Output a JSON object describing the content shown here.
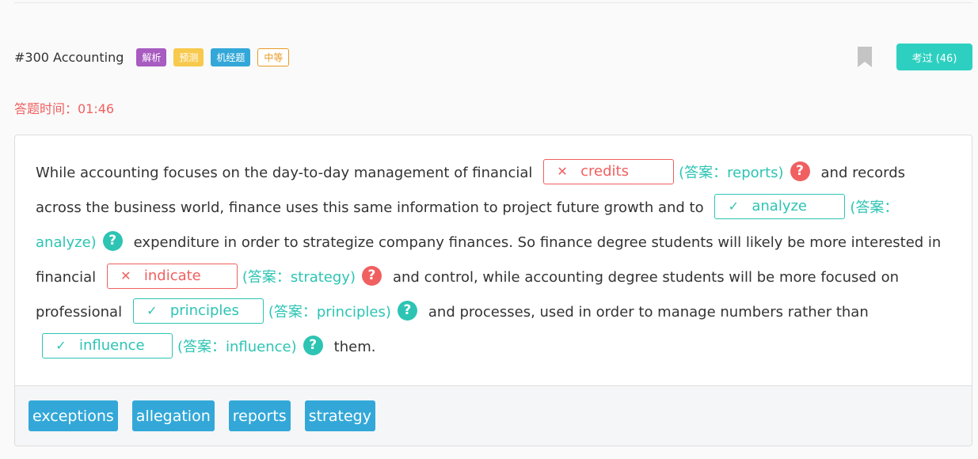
{
  "question": {
    "title": "#300 Accounting",
    "tags": [
      "解析",
      "预测",
      "机经题",
      "中等"
    ],
    "kaoguo_label": "考过 (46)",
    "timer": "答题时间：01:46"
  },
  "passage": {
    "text1": "While accounting focuses on the day-to-day management of financial",
    "text2": "and records across the business world, finance uses this same information to project future growth and to",
    "text3": "expenditure in order to strategize company finances. So finance degree students will likely be more interested in financial",
    "text4": "and control, while accounting degree students will be more focused on professional",
    "text5": "and processes, used in order to manage numbers rather than",
    "text6": "them.",
    "blanks": [
      {
        "mark": "✕",
        "value": "credits",
        "answer": "(答案：reports)",
        "status": "wrong"
      },
      {
        "mark": "✓",
        "value": "analyze",
        "answer": "(答案：analyze)",
        "status": "right"
      },
      {
        "mark": "✕",
        "value": "indicate",
        "answer": "(答案：strategy)",
        "status": "wrong"
      },
      {
        "mark": "✓",
        "value": "principles",
        "answer": "(答案：principles)",
        "status": "right"
      },
      {
        "mark": "✓",
        "value": "influence",
        "answer": "(答案：influence)",
        "status": "right"
      }
    ],
    "help_glyph": "?"
  },
  "word_bank": [
    "exceptions",
    "allegation",
    "reports",
    "strategy"
  ],
  "colors": {
    "accent": "#2dd0c0",
    "wrong": "#f06060",
    "right": "#2dc4b4",
    "word_bg": "#33a8d8"
  }
}
